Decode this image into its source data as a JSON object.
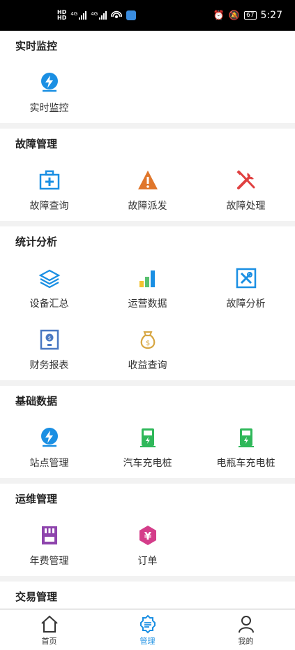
{
  "status_bar": {
    "hd": "HD",
    "network1": "4G",
    "network2": "4G",
    "battery": "67",
    "time": "5:27"
  },
  "sections": [
    {
      "title": "实时监控",
      "items": [
        {
          "label": "实时监控",
          "icon": "lightning-pin-icon"
        }
      ]
    },
    {
      "title": "故障管理",
      "items": [
        {
          "label": "故障查询",
          "icon": "medical-kit-icon"
        },
        {
          "label": "故障派发",
          "icon": "warning-triangle-icon"
        },
        {
          "label": "故障处理",
          "icon": "tools-icon"
        }
      ]
    },
    {
      "title": "统计分析",
      "items": [
        {
          "label": "设备汇总",
          "icon": "layers-icon"
        },
        {
          "label": "运营数据",
          "icon": "bar-chart-icon"
        },
        {
          "label": "故障分析",
          "icon": "wrench-box-icon"
        },
        {
          "label": "财务报表",
          "icon": "finance-report-icon"
        },
        {
          "label": "收益查询",
          "icon": "money-bag-icon"
        }
      ]
    },
    {
      "title": "基础数据",
      "items": [
        {
          "label": "站点管理",
          "icon": "lightning-pin-icon"
        },
        {
          "label": "汽车充电桩",
          "icon": "charger-green-icon"
        },
        {
          "label": "电瓶车充电桩",
          "icon": "charger-green-icon"
        }
      ]
    },
    {
      "title": "运维管理",
      "items": [
        {
          "label": "年费管理",
          "icon": "sd-card-icon"
        },
        {
          "label": "订单",
          "icon": "yuan-badge-icon"
        }
      ]
    },
    {
      "title": "交易管理",
      "items": []
    }
  ],
  "tabs": [
    {
      "label": "首页",
      "icon": "home-icon"
    },
    {
      "label": "管理",
      "icon": "settings-gear-icon",
      "active": true
    },
    {
      "label": "我的",
      "icon": "user-icon"
    }
  ],
  "colors": {
    "blue": "#1a8fe3",
    "orange": "#e0762b",
    "red": "#e04040",
    "green": "#2fb85a",
    "purple": "#8e44ad",
    "magenta": "#d43d8a",
    "gold": "#d7a642"
  }
}
